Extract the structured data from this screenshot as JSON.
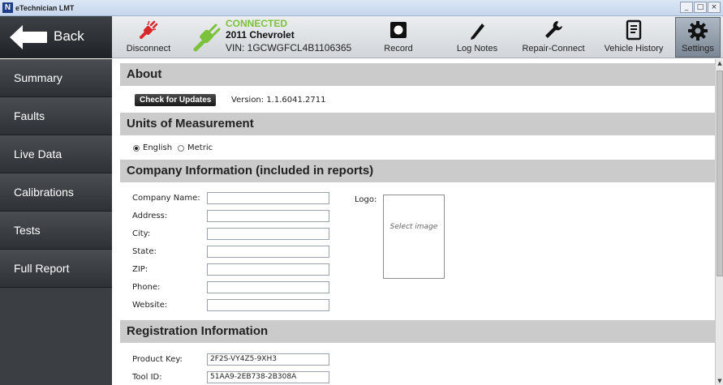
{
  "window": {
    "title": "eTechnician LMT",
    "icon_letter": "N",
    "controls": [
      "_",
      "□",
      "×"
    ]
  },
  "toolbar": {
    "back_label": "Back",
    "disconnect_label": "Disconnect",
    "connection": {
      "status": "CONNECTED",
      "vehicle": "2011 Chevrolet",
      "vin": "VIN: 1GCWGFCL4B1106365"
    },
    "record_label": "Record",
    "log_notes_label": "Log Notes",
    "repair_connect_label": "Repair-Connect",
    "vehicle_history_label": "Vehicle History",
    "settings_label": "Settings"
  },
  "sidebar": {
    "items": [
      {
        "label": "Summary"
      },
      {
        "label": "Faults"
      },
      {
        "label": "Live Data"
      },
      {
        "label": "Calibrations"
      },
      {
        "label": "Tests"
      },
      {
        "label": "Full Report"
      }
    ]
  },
  "about": {
    "header": "About",
    "check_updates": "Check for Updates",
    "version": "Version:  1.1.6041.2711"
  },
  "units": {
    "header": "Units of Measurement",
    "english": "English",
    "metric": "Metric",
    "selected": "English"
  },
  "company": {
    "header": "Company Information (included in reports)",
    "fields": [
      {
        "label": "Company Name:",
        "value": ""
      },
      {
        "label": "Address:",
        "value": ""
      },
      {
        "label": "City:",
        "value": ""
      },
      {
        "label": "State:",
        "value": ""
      },
      {
        "label": "ZIP:",
        "value": ""
      },
      {
        "label": "Phone:",
        "value": ""
      },
      {
        "label": "Website:",
        "value": ""
      }
    ],
    "logo_label": "Logo:",
    "select_image": "Select image"
  },
  "registration": {
    "header": "Registration Information",
    "product_key_label": "Product Key:",
    "product_key": "2F2S-VY4Z5-9XH3",
    "tool_id_label": "Tool ID:",
    "tool_id": "51AA9-2EB738-2B308A"
  },
  "colors": {
    "connected_green": "#7cc13b",
    "disconnect_red": "#d9262b",
    "sidebar_dark": "#3b3e42",
    "section_header_gray": "#cbcbcb"
  }
}
